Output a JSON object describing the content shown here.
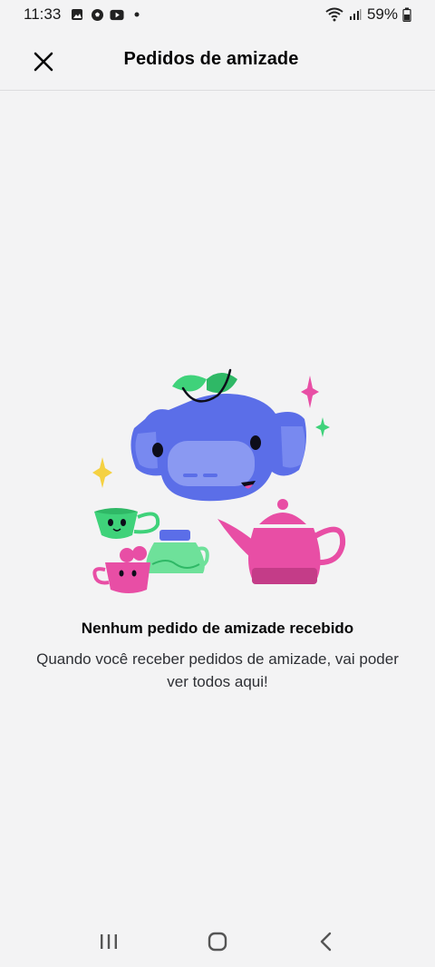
{
  "status_bar": {
    "time": "11:33",
    "battery": "59%",
    "icons": [
      "gallery-icon",
      "soccer-ball-icon",
      "youtube-icon",
      "dot-icon",
      "wifi-icon",
      "signal-icon",
      "battery-icon"
    ]
  },
  "header": {
    "title": "Pedidos de amizade",
    "close_icon": "close-icon"
  },
  "empty_state": {
    "illustration": "wumpus-tea-party-illustration",
    "title": "Nenhum pedido de amizade recebido",
    "description": "Quando você receber pedidos de amizade, vai poder ver todos aqui!"
  },
  "nav_bar": {
    "icons": [
      "recent-apps-icon",
      "home-icon",
      "back-icon"
    ]
  },
  "colors": {
    "background": "#f3f3f4",
    "wumpus_blue": "#5b6ee8",
    "teapot_pink": "#e84ea5",
    "leaf_green": "#3fd27a",
    "sparkle_yellow": "#f5d142"
  }
}
